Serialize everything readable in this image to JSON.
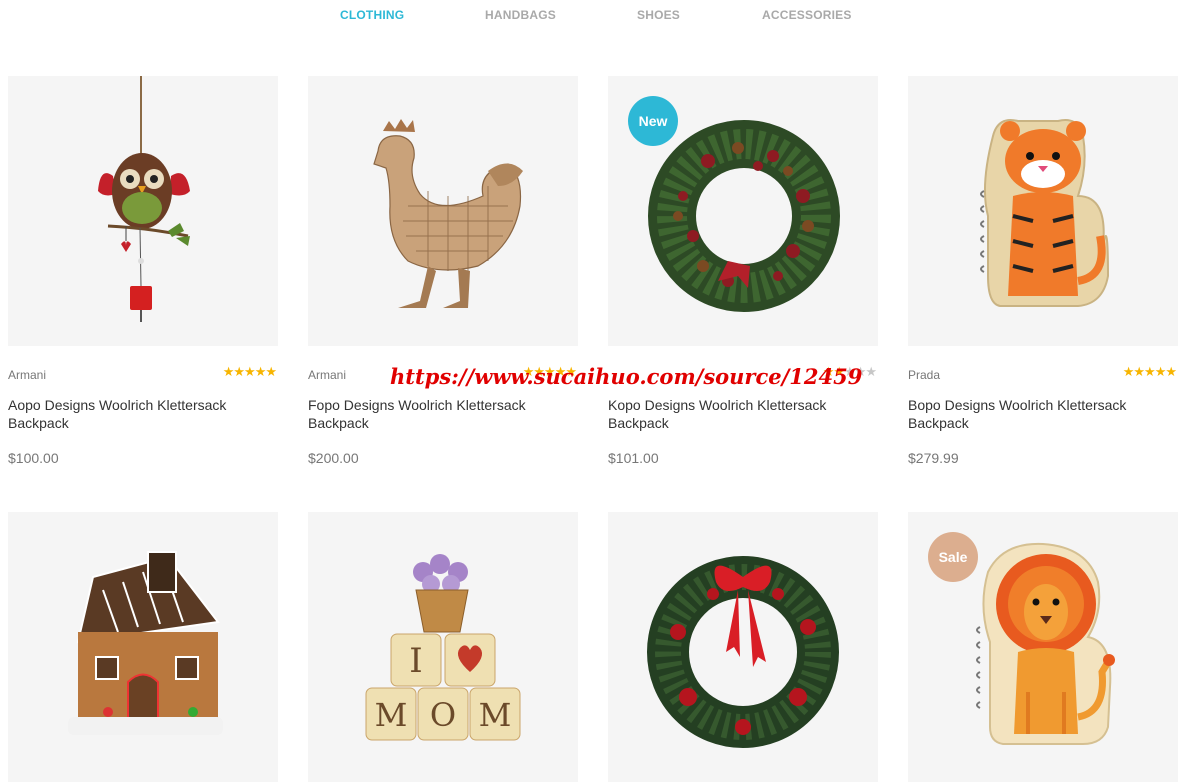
{
  "tabs": [
    {
      "label": "CLOTHING",
      "active": true
    },
    {
      "label": "HANDBAGS",
      "active": false
    },
    {
      "label": "SHOES",
      "active": false
    },
    {
      "label": "ACCESSORIES",
      "active": false
    }
  ],
  "colors": {
    "accent": "#2db8d6",
    "new_badge": "#2db8d6",
    "sale_badge": "#dcae8f",
    "star": "#f7b500",
    "watermark": "#e00000"
  },
  "products": [
    {
      "image": "owl-ornament-icon",
      "badge": "",
      "brand": "Armani",
      "rating": 5,
      "name": "Aopo Designs Woolrich Klettersack Backpack",
      "price": "$100.00"
    },
    {
      "image": "wooden-rooster-icon",
      "badge": "",
      "brand": "Armani",
      "rating": 5,
      "name": "Fopo Designs Woolrich Klettersack Backpack",
      "price": "$200.00"
    },
    {
      "image": "christmas-wreath-icon",
      "badge": "New",
      "brand": "",
      "rating": 1.5,
      "name": "Kopo Designs Woolrich Klettersack Backpack",
      "price": "$101.00"
    },
    {
      "image": "tiger-notebook-icon",
      "badge": "",
      "brand": "Prada",
      "rating": 4.5,
      "name": "Bopo Designs Woolrich Klettersack Backpack",
      "price": "$279.99"
    },
    {
      "image": "gingerbread-house-icon",
      "badge": "",
      "brand": "",
      "rating": 0,
      "name": "",
      "price": ""
    },
    {
      "image": "mom-blocks-icon",
      "badge": "",
      "brand": "",
      "rating": 0,
      "name": "",
      "price": ""
    },
    {
      "image": "red-bow-wreath-icon",
      "badge": "",
      "brand": "",
      "rating": 0,
      "name": "",
      "price": ""
    },
    {
      "image": "lion-notebook-icon",
      "badge": "Sale",
      "brand": "",
      "rating": 0,
      "name": "",
      "price": ""
    }
  ],
  "mom_blocks": {
    "letters": [
      "I",
      "M",
      "O",
      "M"
    ]
  },
  "watermark": "https://www.sucaihuo.com/source/12459"
}
